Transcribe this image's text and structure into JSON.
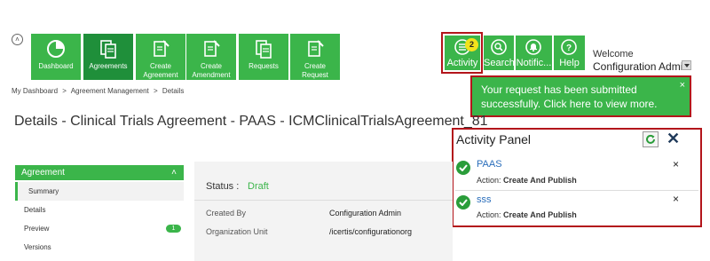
{
  "toolbar": {
    "tiles": [
      {
        "label": "Dashboard",
        "icon": "dashboard-pie-icon"
      },
      {
        "label": "Agreements",
        "icon": "agreements-docs-icon"
      },
      {
        "label": "Create Agreement",
        "icon": "create-agreement-icon"
      },
      {
        "label": "Create Amendment",
        "icon": "create-amendment-icon"
      },
      {
        "label": "Requests",
        "icon": "requests-docs-icon"
      },
      {
        "label": "Create Request",
        "icon": "create-request-icon"
      }
    ],
    "right_tiles": [
      {
        "label": "Activity",
        "icon": "activity-list-icon",
        "badge": "2"
      },
      {
        "label": "Search",
        "icon": "search-icon"
      },
      {
        "label": "Notific...",
        "icon": "bell-icon"
      },
      {
        "label": "Help",
        "icon": "help-icon"
      }
    ],
    "welcome": "Welcome",
    "user_name": "Configuration Admin"
  },
  "breadcrumb": [
    "My Dashboard",
    ">",
    "Agreement Management",
    ">",
    "Details"
  ],
  "toast": {
    "message": "Your request has been submitted successfully. Click here to view more.",
    "close": "×"
  },
  "page_title": "Details - Clinical Trials Agreement - PAAS - ICMClinicalTrialsAgreement_81",
  "activity_panel": {
    "title": "Activity Panel",
    "close": "✕",
    "items": [
      {
        "title": "PAAS",
        "action_label": "Action:",
        "action": "Create And Publish",
        "close": "×"
      },
      {
        "title": "sss",
        "action_label": "Action:",
        "action": "Create And Publish",
        "close": "×"
      }
    ]
  },
  "sidebar": {
    "header": "Agreement",
    "items": [
      {
        "label": "Summary"
      },
      {
        "label": "Details"
      },
      {
        "label": "Preview",
        "count": "1"
      },
      {
        "label": "Versions"
      }
    ]
  },
  "details": {
    "status_label": "Status :",
    "status_value": "Draft",
    "fields": [
      {
        "label": "Created By",
        "value": "Configuration Admin"
      },
      {
        "label": "Organization Unit",
        "value": "/icertis/configurationorg"
      }
    ]
  },
  "colors": {
    "accent": "#3bb54a",
    "accent_dark": "#1f8f3a",
    "highlight": "#b3151b",
    "link": "#2a6ebb"
  }
}
